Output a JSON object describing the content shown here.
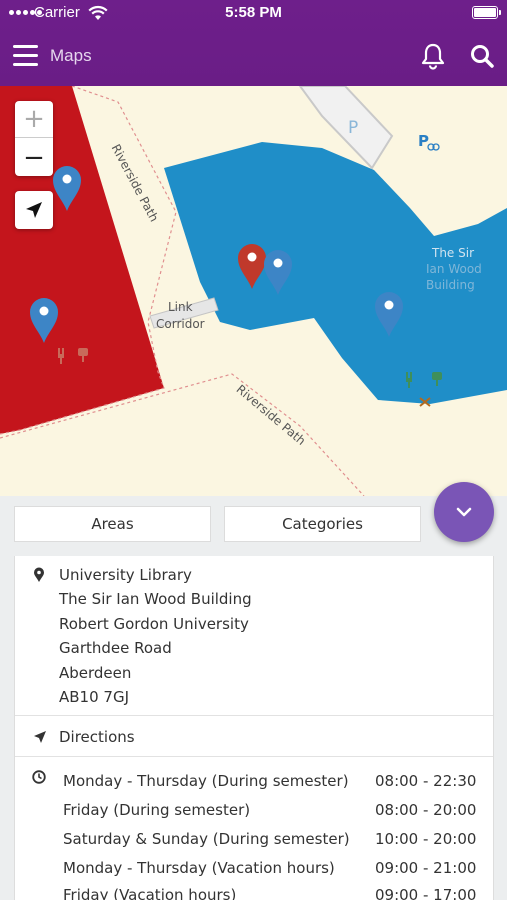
{
  "status_bar": {
    "carrier": "Carrier",
    "time": "5:58 PM"
  },
  "header": {
    "title": "Maps"
  },
  "map": {
    "labels": {
      "riverside_path_1": "Riverside Path",
      "riverside_path_2": "Riverside Path",
      "link_corridor_1": "Link",
      "link_corridor_2": "Corridor",
      "building_1": "The Sir",
      "building_2": "Ian Wood",
      "building_3": "Building",
      "parking": "P"
    },
    "zoom_in": "+",
    "zoom_out": "−"
  },
  "tabs": {
    "areas": "Areas",
    "categories": "Categories"
  },
  "address": {
    "lines": [
      "University Library",
      "The Sir Ian Wood Building",
      "Robert Gordon University",
      "Garthdee Road",
      "Aberdeen",
      "AB10 7GJ"
    ]
  },
  "directions": {
    "label": "Directions"
  },
  "hours": [
    {
      "day": "Monday - Thursday (During semester)",
      "time": "08:00 - 22:30"
    },
    {
      "day": "Friday (During semester)",
      "time": "08:00 - 20:00"
    },
    {
      "day": "Saturday & Sunday (During semester)",
      "time": "10:00 - 20:00"
    },
    {
      "day": "Monday - Thursday (Vacation hours)",
      "time": "09:00 - 21:00"
    },
    {
      "day": "Friday (Vacation hours)",
      "time": "09:00 - 17:00"
    }
  ],
  "colors": {
    "header": "#6e1f8b",
    "fab": "#7a55b6",
    "building_red": "#c4151c",
    "building_blue": "#1f8ec8",
    "pin_blue": "#3d85c6",
    "pin_red": "#c0392b"
  }
}
